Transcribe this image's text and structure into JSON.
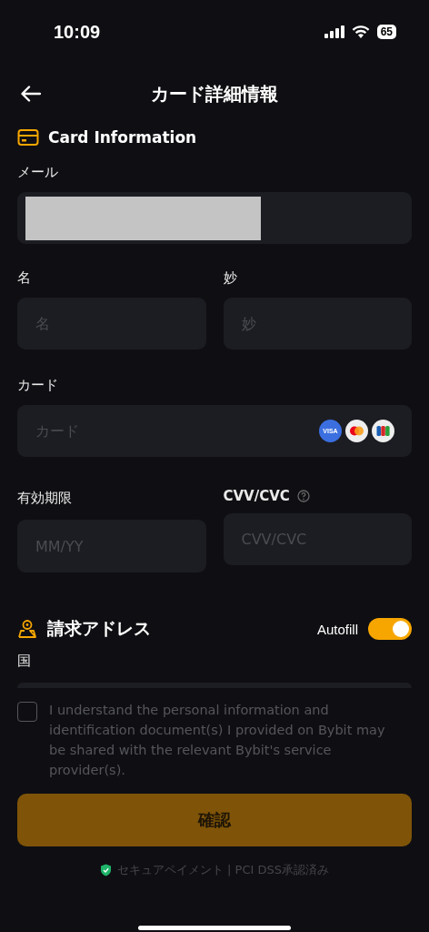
{
  "status_bar": {
    "time": "10:09",
    "battery": "65"
  },
  "header": {
    "title": "カード詳細情報"
  },
  "card_section": {
    "title": "Card Information"
  },
  "email": {
    "label": "メール",
    "redacted": true
  },
  "first_name": {
    "label": "名",
    "placeholder": "名"
  },
  "last_name": {
    "label": "妙",
    "placeholder": "妙"
  },
  "card": {
    "label": "カード",
    "placeholder": "カード",
    "brands": [
      "VISA"
    ]
  },
  "expiry": {
    "label": "有効期限",
    "placeholder": "MM/YY"
  },
  "cvv": {
    "label": "CVV/CVC",
    "placeholder": "CVV/CVC"
  },
  "billing": {
    "title": "請求アドレス",
    "autofill_label": "Autofill",
    "autofill_on": true
  },
  "country": {
    "label": "国"
  },
  "consent": {
    "checked": false,
    "text": "I understand the personal information and identification document(s) I provided on Bybit may be shared with the relevant Bybit's service provider(s)."
  },
  "confirm_button": {
    "label": "確認",
    "disabled": true
  },
  "footer": {
    "text": "セキュアペイメント | PCI DSS承認済み"
  }
}
